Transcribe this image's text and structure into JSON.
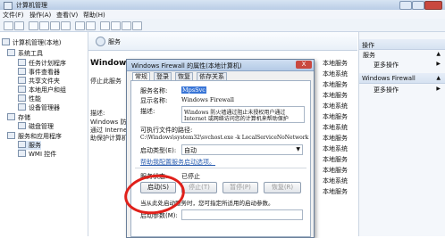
{
  "window": {
    "title": "计算机管理"
  },
  "menu": [
    "文件(F)",
    "操作(A)",
    "查看(V)",
    "帮助(H)"
  ],
  "tree": [
    {
      "label": "计算机管理(本地)",
      "level": 0
    },
    {
      "label": "系统工具",
      "level": 1
    },
    {
      "label": "任务计划程序",
      "level": 2
    },
    {
      "label": "事件查看器",
      "level": 2
    },
    {
      "label": "共享文件夹",
      "level": 2
    },
    {
      "label": "本地用户和组",
      "level": 2
    },
    {
      "label": "性能",
      "level": 2
    },
    {
      "label": "设备管理器",
      "level": 2
    },
    {
      "label": "存储",
      "level": 1
    },
    {
      "label": "磁盘管理",
      "level": 2
    },
    {
      "label": "服务和应用程序",
      "level": 1
    },
    {
      "label": "服务",
      "level": 2,
      "selected": true
    },
    {
      "label": "WMI 控件",
      "level": 2
    }
  ],
  "center": {
    "header": "服务",
    "service_name": "Windows Fire",
    "desc_lines": [
      "停止此服务",
      "",
      "描述:",
      "Windows 防火",
      "通过 Internet",
      "助保护计算机"
    ],
    "status_col": [
      "本地服务",
      "本地系统",
      "本地服务",
      "本地服务",
      "本地系统",
      "本地服务",
      "本地系统",
      "本地服务",
      "本地系统",
      "本地服务",
      "本地服务",
      "本地系统",
      "本地服务"
    ]
  },
  "actions": {
    "section1": "操作",
    "section1_sub": "服务",
    "more1": "更多操作",
    "section2": "Windows Firewall",
    "more2": "更多操作"
  },
  "dialog": {
    "title": "Windows Firewall 的属性(本地计算机)",
    "close": "X",
    "tabs": [
      "常规",
      "登录",
      "恢复",
      "依存关系"
    ],
    "service_name_label": "服务名称:",
    "service_name": "MpsSvc",
    "display_name_label": "显示名称:",
    "display_name": "Windows Firewall",
    "desc_label": "描述:",
    "desc_line1": "Windows 防火墙通过阻止未授权用户通过",
    "desc_line2": "Internet 或网络访问您的计算机来帮助保护",
    "path_label": "可执行文件的路径:",
    "path": "C:\\Windows\\system32\\svchost.exe -k LocalServiceNoNetwork",
    "startup_type_label": "启动类型(E):",
    "startup_type": "自动",
    "help_link": "帮助我配置服务启动选项。",
    "status_label": "服务状态:",
    "status": "已停止",
    "buttons": {
      "start": "启动(S)",
      "stop": "停止(T)",
      "pause": "暂停(P)",
      "resume": "恢复(R)"
    },
    "start_params_hint": "当从此处启动服务时，您可指定所适用的启动参数。",
    "start_params_label": "启动参数(M):"
  }
}
